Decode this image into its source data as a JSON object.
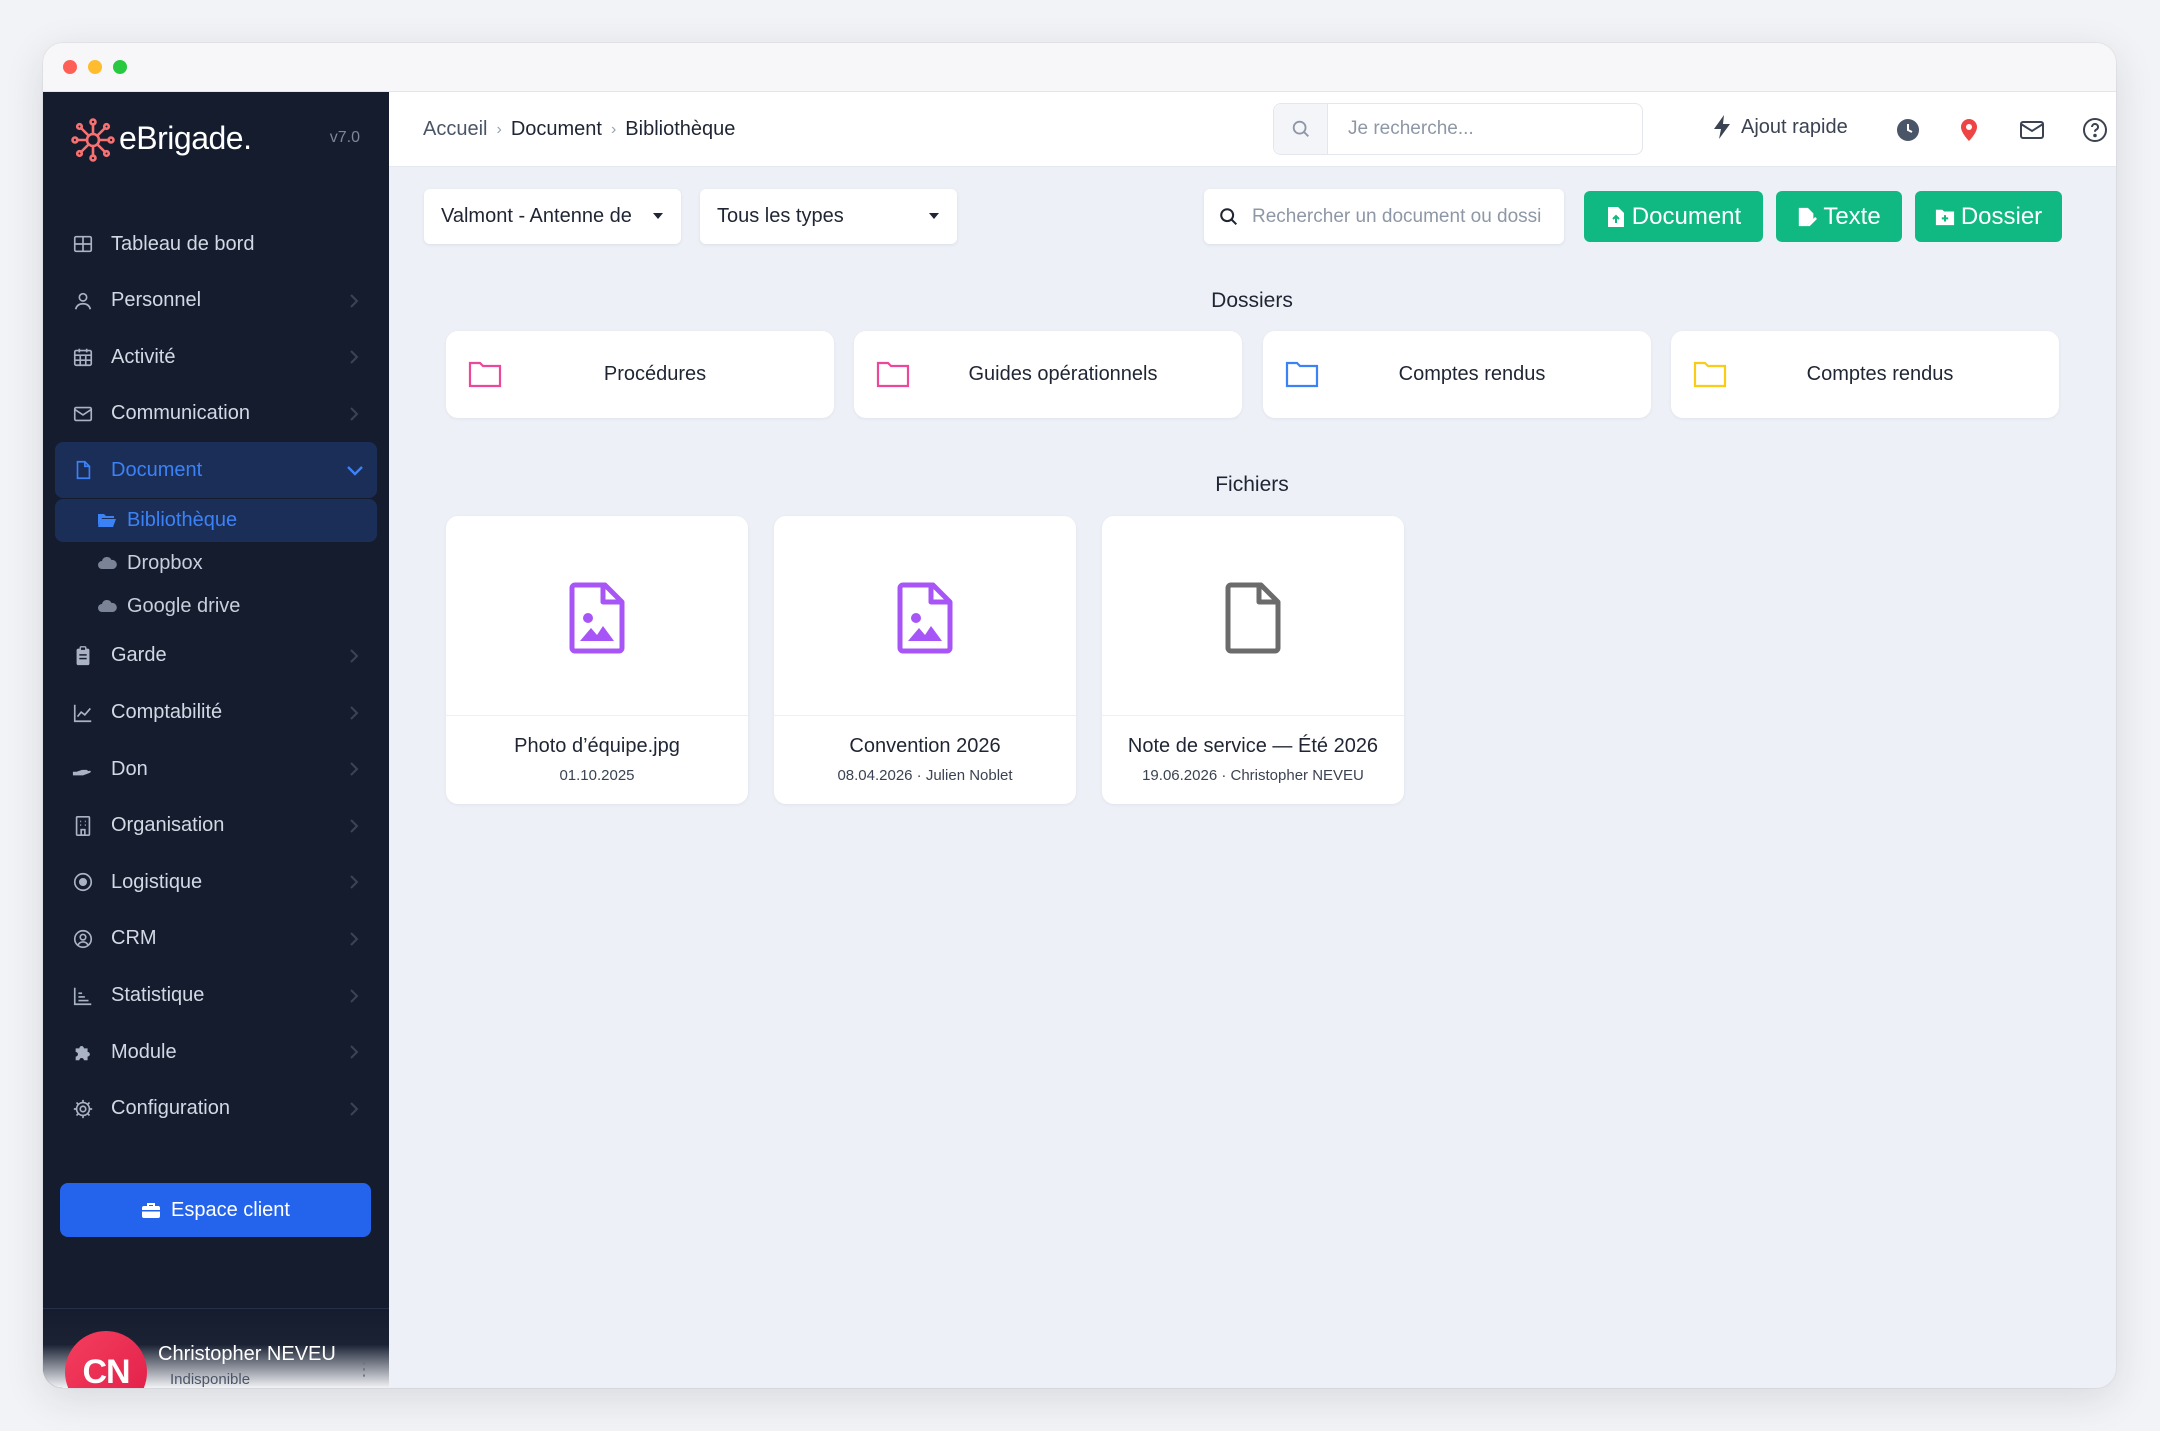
{
  "app": {
    "brand": "eBrigade.",
    "version": "v7.0"
  },
  "sidebar": {
    "items": [
      {
        "label": "Tableau de bord",
        "icon": "dashboard-icon"
      },
      {
        "label": "Personnel",
        "icon": "user-icon"
      },
      {
        "label": "Activité",
        "icon": "calendar-icon"
      },
      {
        "label": "Communication",
        "icon": "mail-icon"
      },
      {
        "label": "Document",
        "icon": "file-icon"
      },
      {
        "label": "Garde",
        "icon": "clipboard-icon"
      },
      {
        "label": "Comptabilité",
        "icon": "chart-line-icon"
      },
      {
        "label": "Don",
        "icon": "hand-icon"
      },
      {
        "label": "Organisation",
        "icon": "building-icon"
      },
      {
        "label": "Logistique",
        "icon": "target-icon"
      },
      {
        "label": "CRM",
        "icon": "user-circle-icon"
      },
      {
        "label": "Statistique",
        "icon": "bar-chart-icon"
      },
      {
        "label": "Module",
        "icon": "puzzle-icon"
      },
      {
        "label": "Configuration",
        "icon": "gear-icon"
      }
    ],
    "document_sub": [
      {
        "label": "Bibliothèque",
        "icon": "folder-open-icon"
      },
      {
        "label": "Dropbox",
        "icon": "cloud-icon"
      },
      {
        "label": "Google drive",
        "icon": "cloud-icon"
      }
    ],
    "client_button": "Espace client",
    "user": {
      "initials": "CN",
      "name": "Christopher NEVEU",
      "status": "Indisponible"
    }
  },
  "header": {
    "breadcrumb": [
      "Accueil",
      "Document",
      "Bibliothèque"
    ],
    "search_placeholder": "Je recherche...",
    "quick_add": "Ajout rapide"
  },
  "toolbar": {
    "structure_select": "Valmont - Antenne de",
    "type_select": "Tous les types",
    "doc_search_placeholder": "Rechercher un document ou dossier",
    "buttons": [
      "Document",
      "Texte",
      "Dossier"
    ]
  },
  "folders_title": "Dossiers",
  "folders": [
    {
      "label": "Procédures",
      "color": "#ec4899"
    },
    {
      "label": "Guides opérationnels",
      "color": "#ec4899"
    },
    {
      "label": "Comptes rendus",
      "color": "#3b82f6"
    },
    {
      "label": "Comptes rendus",
      "color": "#facc15"
    }
  ],
  "files_title": "Fichiers",
  "files": [
    {
      "name": "Photo d’équipe.jpg",
      "meta": "01.10.2025",
      "icon": "file-image-icon"
    },
    {
      "name": "Convention 2026",
      "meta": "08.04.2026 · Julien Noblet",
      "icon": "file-image-icon"
    },
    {
      "name": "Note de service — Été 2026",
      "meta": "19.06.2026 · Christopher NEVEU",
      "icon": "file-icon"
    }
  ],
  "colors": {
    "accent": "#3b82f6",
    "green": "#10b981",
    "sidebar_bg": "#141c2e",
    "purple": "#a855f7"
  }
}
